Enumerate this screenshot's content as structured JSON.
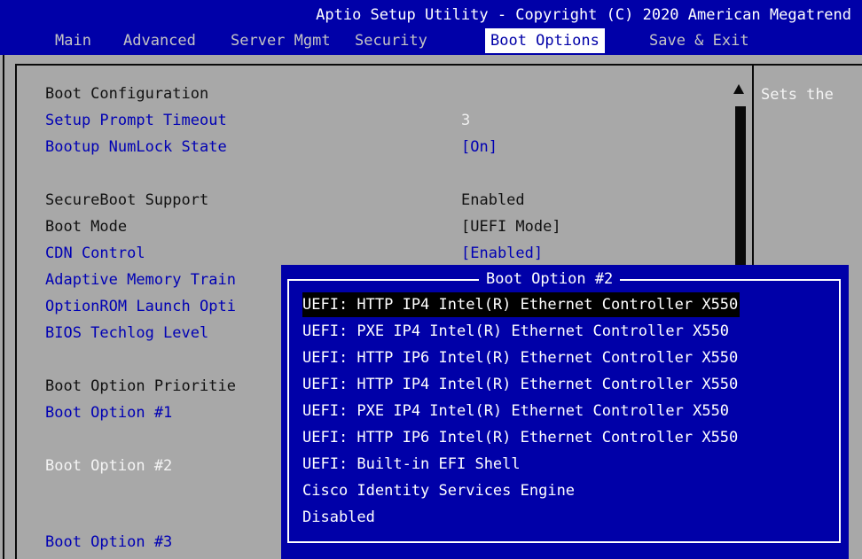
{
  "header": {
    "title": "Aptio Setup Utility - Copyright (C) 2020 American Megatrend",
    "tabs": [
      {
        "label": "Main"
      },
      {
        "label": "Advanced"
      },
      {
        "label": "Server Mgmt"
      },
      {
        "label": "Security"
      },
      {
        "label": "Boot Options",
        "active": true
      },
      {
        "label": "Save & Exit"
      }
    ]
  },
  "settings": {
    "section_boot_config": "Boot Configuration",
    "setup_prompt_timeout": {
      "label": "Setup Prompt Timeout",
      "value": "3"
    },
    "bootup_numlock_state": {
      "label": "Bootup NumLock State",
      "value": "[On]"
    },
    "secureboot_support": {
      "label": "SecureBoot Support",
      "value": "Enabled"
    },
    "boot_mode": {
      "label": "Boot Mode",
      "value": "[UEFI Mode]"
    },
    "cdn_control": {
      "label": "CDN Control",
      "value": "[Enabled]"
    },
    "adaptive_memory_training": {
      "label": "Adaptive Memory Train"
    },
    "optionrom_launch": {
      "label": "OptionROM Launch Opti"
    },
    "bios_techlog_level": {
      "label": "BIOS Techlog Level"
    },
    "section_boot_priorities": "Boot Option Prioritie",
    "boot_option_1": {
      "label": "Boot Option #1"
    },
    "boot_option_2": {
      "label": "Boot Option #2"
    },
    "boot_option_3": {
      "label": "Boot Option #3"
    }
  },
  "help": {
    "text": "Sets the"
  },
  "popup": {
    "title": "Boot Option #2",
    "selected_index": 0,
    "options": [
      "UEFI: HTTP IP4 Intel(R) Ethernet Controller X550",
      "UEFI: PXE IP4 Intel(R) Ethernet Controller X550",
      "UEFI: HTTP IP6 Intel(R) Ethernet Controller X550",
      "UEFI: HTTP IP4 Intel(R) Ethernet Controller X550",
      "UEFI: PXE IP4 Intel(R) Ethernet Controller X550",
      "UEFI: HTTP IP6 Intel(R) Ethernet Controller X550",
      "UEFI: Built-in EFI Shell",
      "Cisco Identity Services Engine",
      "Disabled"
    ]
  },
  "colors": {
    "header_bg": "#0000a8",
    "panel_bg": "#a8a8a8",
    "selectable_text": "#0000b4",
    "popup_bg": "#0000a8"
  }
}
